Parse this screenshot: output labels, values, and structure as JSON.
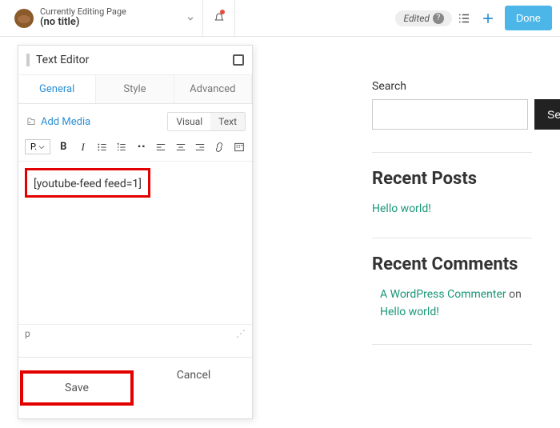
{
  "topbar": {
    "pageLabel": "Currently Editing Page",
    "pageTitle": "(no title)",
    "editedLabel": "Edited",
    "doneLabel": "Done"
  },
  "panel": {
    "title": "Text Editor",
    "tabs": {
      "general": "General",
      "style": "Style",
      "advanced": "Advanced"
    },
    "addMedia": "Add Media",
    "visualTab": "Visual",
    "textTab": "Text",
    "formatSelector": "P.",
    "shortcode": "[youtube-feed feed=1]",
    "statusPath": "p",
    "saveLabel": "Save",
    "cancelLabel": "Cancel"
  },
  "sidebar": {
    "searchLabel": "Search",
    "searchButton": "Search",
    "recentPostsTitle": "Recent Posts",
    "post1": "Hello world!",
    "recentCommentsTitle": "Recent Comments",
    "commenter": "A WordPress Commenter",
    "onText": "on",
    "commentPost": "Hello world!"
  }
}
